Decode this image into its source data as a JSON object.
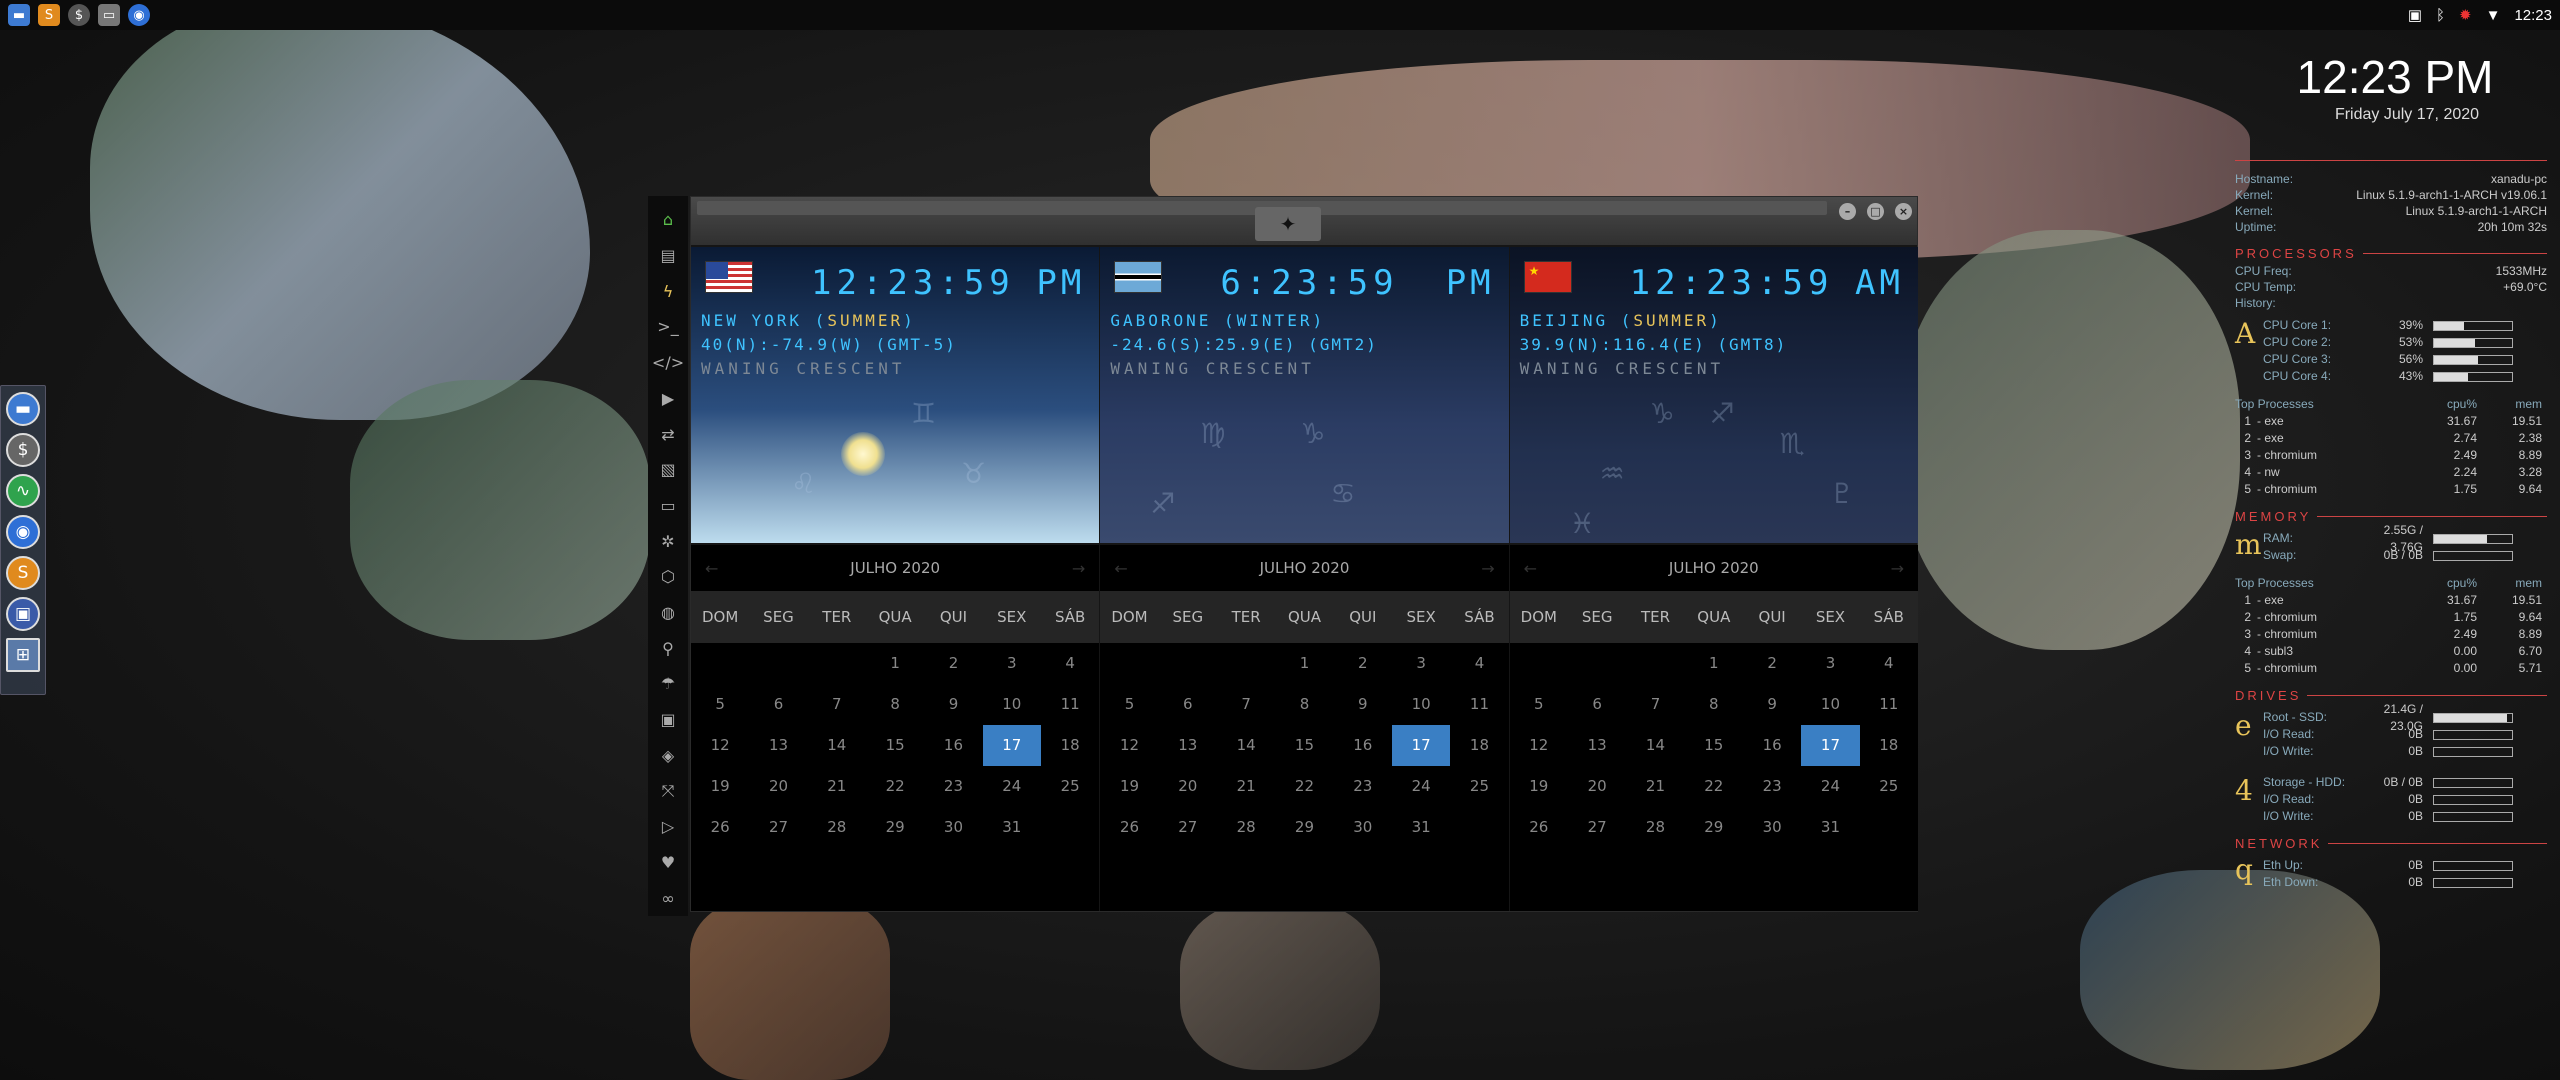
{
  "topbar": {
    "icons": [
      "folder-icon",
      "sublime-icon",
      "terminal-icon",
      "chrome-icon"
    ],
    "status_icons": [
      "screenshot-icon",
      "bluetooth-icon",
      "alert-icon",
      "wifi-icon"
    ],
    "clock": "12:23"
  },
  "dock": {
    "items": [
      "files-icon",
      "money-icon",
      "activity-icon",
      "chrome-icon",
      "sublime-icon",
      "screenshot-icon",
      "network-icon"
    ]
  },
  "sidebar": {
    "items": [
      "home-icon",
      "document-icon",
      "bolt-icon",
      "terminal-icon",
      "code-icon",
      "play-icon",
      "sync-icon",
      "image-icon",
      "card-icon",
      "film-icon",
      "hexagon-icon",
      "globe-icon",
      "search-icon",
      "umbrella-icon",
      "id-icon",
      "tags-icon",
      "expand-icon",
      "youtube-icon",
      "heart-icon",
      "infinity-icon"
    ]
  },
  "clocks": [
    {
      "time": "12:23:59",
      "ampm": "PM",
      "city": "NEW YORK (",
      "season": "SUMMER",
      "close": ")",
      "coords": "40(N):-74.9(W) (GMT-5)",
      "moon": "WANING CRESCENT"
    },
    {
      "time": "6:23:59",
      "ampm": "PM",
      "city": "GABORONE (",
      "season": "WINTER",
      "close": ")",
      "coords": "-24.6(S):25.9(E) (GMT2)",
      "moon": "WANING CRESCENT"
    },
    {
      "time": "12:23:59",
      "ampm": "AM",
      "city": "BEIJING (",
      "season": "SUMMER",
      "close": ")",
      "coords": "39.9(N):116.4(E) (GMT8)",
      "moon": "WANING CRESCENT"
    }
  ],
  "calendar": {
    "month": "JULHO 2020",
    "days": [
      "DOM",
      "SEG",
      "TER",
      "QUA",
      "QUI",
      "SEX",
      "SÁB"
    ],
    "weeks": [
      [
        "",
        "",
        "",
        "1",
        "2",
        "3",
        "4"
      ],
      [
        "5",
        "6",
        "7",
        "8",
        "9",
        "10",
        "11"
      ],
      [
        "12",
        "13",
        "14",
        "15",
        "16",
        "17",
        "18"
      ],
      [
        "19",
        "20",
        "21",
        "22",
        "23",
        "24",
        "25"
      ],
      [
        "26",
        "27",
        "28",
        "29",
        "30",
        "31",
        ""
      ]
    ],
    "today": "17"
  },
  "datetime": {
    "time": "12:23 PM",
    "date": "Friday July 17, 2020"
  },
  "conky": {
    "sys": [
      {
        "k": "Hostname:",
        "v": "xanadu-pc"
      },
      {
        "k": "Kernel:",
        "v": "Linux 5.1.9-arch1-1-ARCH v19.06.1"
      },
      {
        "k": "Kernel:",
        "v": "Linux 5.1.9-arch1-1-ARCH"
      },
      {
        "k": "Uptime:",
        "v": "20h 10m 32s"
      }
    ],
    "proc_title": "PROCESSORS",
    "proc_info": [
      {
        "k": "CPU Freq:",
        "v": "1533MHz"
      },
      {
        "k": "CPU Temp:",
        "v": "+69.0°C"
      },
      {
        "k": "History:",
        "v": ""
      }
    ],
    "cpu_letter": "A",
    "cores": [
      {
        "k": "CPU Core 1:",
        "v": "39%",
        "pct": 0.39
      },
      {
        "k": "CPU Core 2:",
        "v": "53%",
        "pct": 0.53
      },
      {
        "k": "CPU Core 3:",
        "v": "56%",
        "pct": 0.56
      },
      {
        "k": "CPU Core 4:",
        "v": "43%",
        "pct": 0.43
      }
    ],
    "top_label": "Top Processes",
    "cpu_col": "cpu%",
    "mem_col": "mem",
    "top_cpu": [
      {
        "n": "1",
        "name": "exe",
        "c": "31.67",
        "m": "19.51"
      },
      {
        "n": "2",
        "name": "exe",
        "c": "2.74",
        "m": "2.38"
      },
      {
        "n": "3",
        "name": "chromium",
        "c": "2.49",
        "m": "8.89"
      },
      {
        "n": "4",
        "name": "nw",
        "c": "2.24",
        "m": "3.28"
      },
      {
        "n": "5",
        "name": "chromium",
        "c": "1.75",
        "m": "9.64"
      }
    ],
    "mem_title": "MEMORY",
    "mem_letter": "m",
    "mem": [
      {
        "k": "RAM:",
        "v": "2.55G / 3.76G",
        "pct": 0.68
      },
      {
        "k": "Swap:",
        "v": "0B / 0B",
        "pct": 0
      }
    ],
    "top_mem": [
      {
        "n": "1",
        "name": "exe",
        "c": "31.67",
        "m": "19.51"
      },
      {
        "n": "2",
        "name": "chromium",
        "c": "1.75",
        "m": "9.64"
      },
      {
        "n": "3",
        "name": "chromium",
        "c": "2.49",
        "m": "8.89"
      },
      {
        "n": "4",
        "name": "subl3",
        "c": "0.00",
        "m": "6.70"
      },
      {
        "n": "5",
        "name": "chromium",
        "c": "0.00",
        "m": "5.71"
      }
    ],
    "drive_title": "DRIVES",
    "drive_letter": "e",
    "drive_root": [
      {
        "k": "Root - SSD:",
        "v": "21.4G / 23.0G",
        "pct": 0.93
      },
      {
        "k": "I/O Read:",
        "v": "0B",
        "pct": 0
      },
      {
        "k": "I/O Write:",
        "v": "0B",
        "pct": 0
      }
    ],
    "storage_letter": "4",
    "drive_storage": [
      {
        "k": "Storage - HDD:",
        "v": "0B / 0B",
        "pct": 0
      },
      {
        "k": "I/O Read:",
        "v": "0B",
        "pct": 0
      },
      {
        "k": "I/O Write:",
        "v": "0B",
        "pct": 0
      }
    ],
    "net_title": "NETWORK",
    "net_letter": "q",
    "net": [
      {
        "k": "Eth Up:",
        "v": "0B",
        "pct": 0
      },
      {
        "k": "Eth Down:",
        "v": "0B",
        "pct": 0
      }
    ]
  }
}
